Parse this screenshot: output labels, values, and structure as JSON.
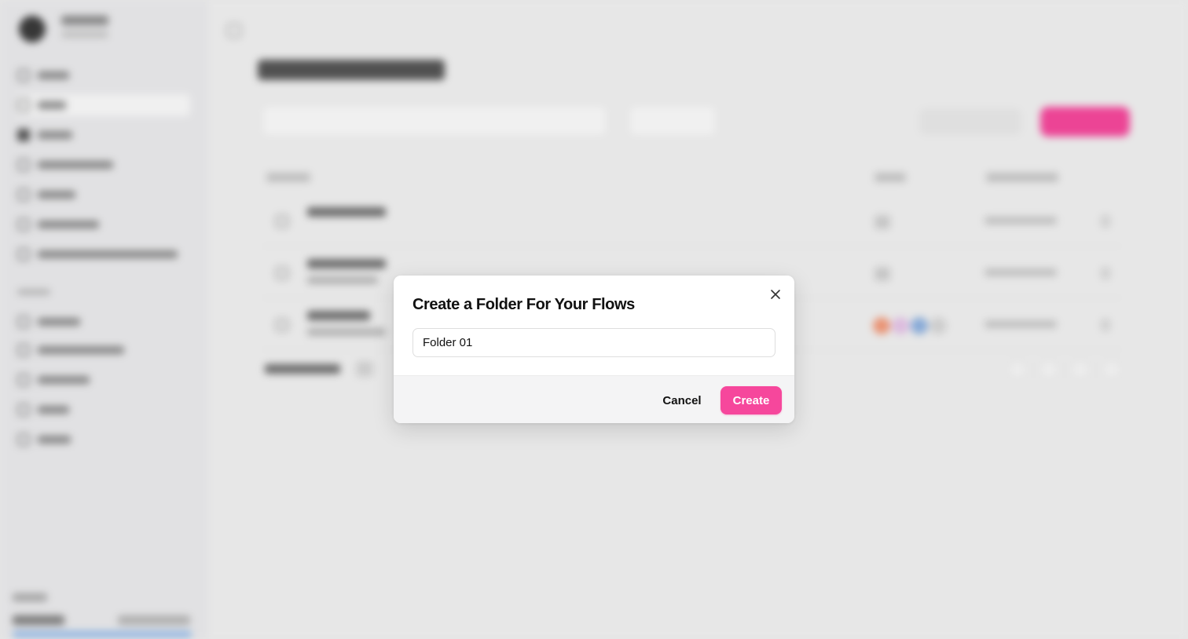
{
  "modal": {
    "title": "Create a Folder For Your Flows",
    "folder_name_value": "Folder 01",
    "cancel_label": "Cancel",
    "create_label": "Create",
    "close_icon": "close-icon"
  },
  "colors": {
    "accent": "#f6479c",
    "footer_bg": "#f4f4f5",
    "text": "#111111"
  }
}
